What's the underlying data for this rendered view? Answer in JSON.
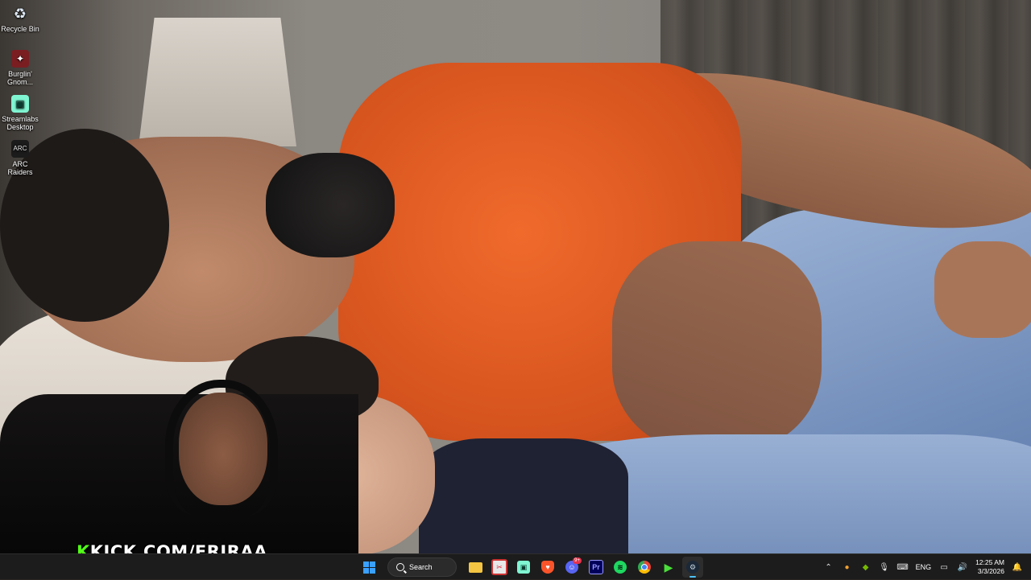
{
  "desktop": {
    "icons": [
      {
        "label": "Recycle Bin",
        "icon": "recycle-bin-icon"
      },
      {
        "label": "Burglin' Gnom...",
        "icon": "burglin-gnomes-icon"
      },
      {
        "label": "Streamlabs Desktop",
        "icon": "streamlabs-icon"
      },
      {
        "label": "ARC Raiders",
        "icon": "arc-raiders-icon"
      }
    ]
  },
  "overlay": {
    "kick_prefix": "K",
    "kick_text": "KICK.COM/FRIRAA"
  },
  "taskbar": {
    "search_label": "Search",
    "apps": [
      {
        "icon": "start-icon"
      },
      {
        "icon": "file-explorer-icon"
      },
      {
        "icon": "snipping-tool-icon"
      },
      {
        "icon": "streamlabs-app-icon"
      },
      {
        "icon": "brave-icon"
      },
      {
        "icon": "discord-icon",
        "badge": "9+"
      },
      {
        "icon": "premiere-pro-icon",
        "text": "Pr"
      },
      {
        "icon": "spotify-icon"
      },
      {
        "icon": "chrome-icon"
      },
      {
        "icon": "game-launcher-icon"
      },
      {
        "icon": "steam-icon",
        "active": true
      }
    ],
    "tray": {
      "language": "ENG",
      "time": "12:25 AM",
      "date": "3/3/2026"
    }
  },
  "colors": {
    "taskbar_bg": "#1c1c1c",
    "kick_green": "#53fc18",
    "accent": "#4cc2ff"
  }
}
